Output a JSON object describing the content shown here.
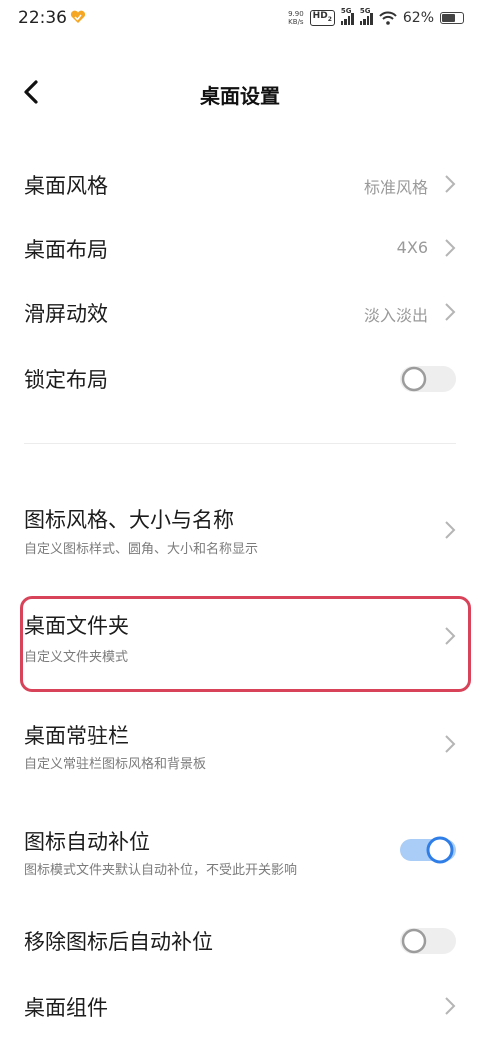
{
  "status": {
    "time": "22:36",
    "speed_value": "9.90",
    "speed_unit": "KB/s",
    "hd": "HD",
    "hd_sub": "2",
    "sig1": "5G",
    "sig2": "5G",
    "battery": "62%"
  },
  "header": {
    "title": "桌面设置"
  },
  "settings": [
    {
      "label": "桌面风格",
      "value": "标准风格"
    },
    {
      "label": "桌面布局",
      "value": "4X6"
    },
    {
      "label": "滑屏动效",
      "value": "淡入淡出"
    },
    {
      "label": "锁定布局",
      "toggle": false
    }
  ],
  "items": [
    {
      "label": "图标风格、大小与名称",
      "sub": "自定义图标样式、圆角、大小和名称显示"
    },
    {
      "label": "桌面文件夹",
      "sub": "自定义文件夹模式"
    },
    {
      "label": "桌面常驻栏",
      "sub": "自定义常驻栏图标风格和背景板"
    },
    {
      "label": "图标自动补位",
      "sub": "图标模式文件夹默认自动补位，不受此开关影响",
      "toggle": true
    },
    {
      "label": "移除图标后自动补位",
      "toggle": false
    },
    {
      "label": "桌面组件"
    }
  ],
  "colors": {
    "accent": "#2f7ee8",
    "highlight": "#d9435a",
    "toggle_off": "#eeeeee"
  }
}
